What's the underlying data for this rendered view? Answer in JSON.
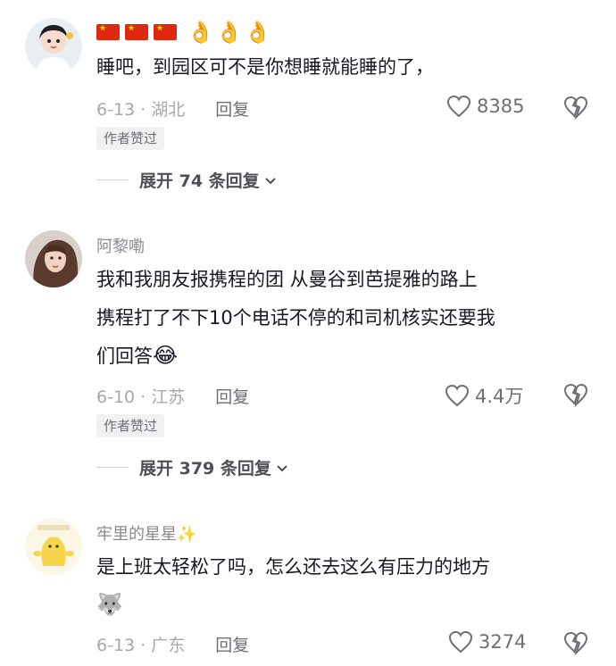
{
  "comments": [
    {
      "username_emoji": [
        "🇨🇳",
        "🇨🇳",
        "🇨🇳",
        "👌",
        "👌",
        "👌"
      ],
      "lines": [
        "睡吧，到园区可不是你想睡就能睡的了，"
      ],
      "date_location": "6-13 · 湖北",
      "reply_label": "回复",
      "likes": "8385",
      "author_badge": "作者赞过",
      "expand_label": "展开 74 条回复"
    },
    {
      "username": "阿黎嘞",
      "lines": [
        "我和我朋友报携程的团 从曼谷到芭提雅的路上",
        "携程打了不下10个电话不停的和司机核实还要我",
        "们回答"
      ],
      "line_emoji": "😂",
      "date_location": "6-10 · 江苏",
      "reply_label": "回复",
      "likes": "4.4万",
      "author_badge": "作者赞过",
      "expand_label": "展开 379 条回复"
    },
    {
      "username": "牢里的星星",
      "username_emoji": "✨",
      "lines": [
        "是上班太轻松了吗，怎么还去这么有压力的地方"
      ],
      "line_emoji": "🐺",
      "date_location": "6-13 · 广东",
      "reply_label": "回复",
      "likes": "3274"
    }
  ],
  "icons": {
    "like": "heart-outline-icon",
    "dislike": "broken-heart-icon",
    "expand": "chevron-down-icon"
  },
  "colors": {
    "text_primary": "#161823",
    "text_secondary": "#a7a8ad",
    "badge_bg": "#f1f1f2"
  }
}
